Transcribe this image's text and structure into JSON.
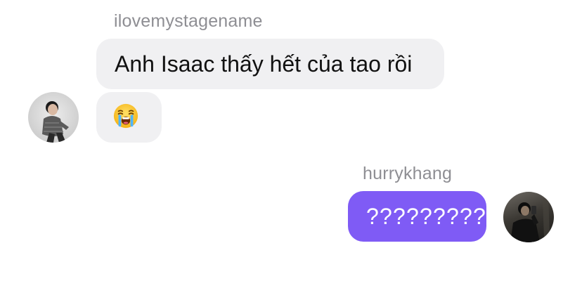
{
  "conversation": {
    "incoming": {
      "sender": "ilovemystagename",
      "avatar_icon": "person-photo-avatar",
      "messages": [
        {
          "text": "Anh Isaac thấy hết của tao rồi"
        },
        {
          "emoji": "crying-face-emoji"
        }
      ]
    },
    "outgoing": {
      "sender": "hurrykhang",
      "avatar_icon": "person-photo-avatar",
      "messages": [
        {
          "text": "?????????"
        }
      ]
    }
  },
  "colors": {
    "incoming_bubble": "#f0f0f2",
    "outgoing_bubble": "#7f5bf5",
    "sender_name": "#8e8e93"
  }
}
